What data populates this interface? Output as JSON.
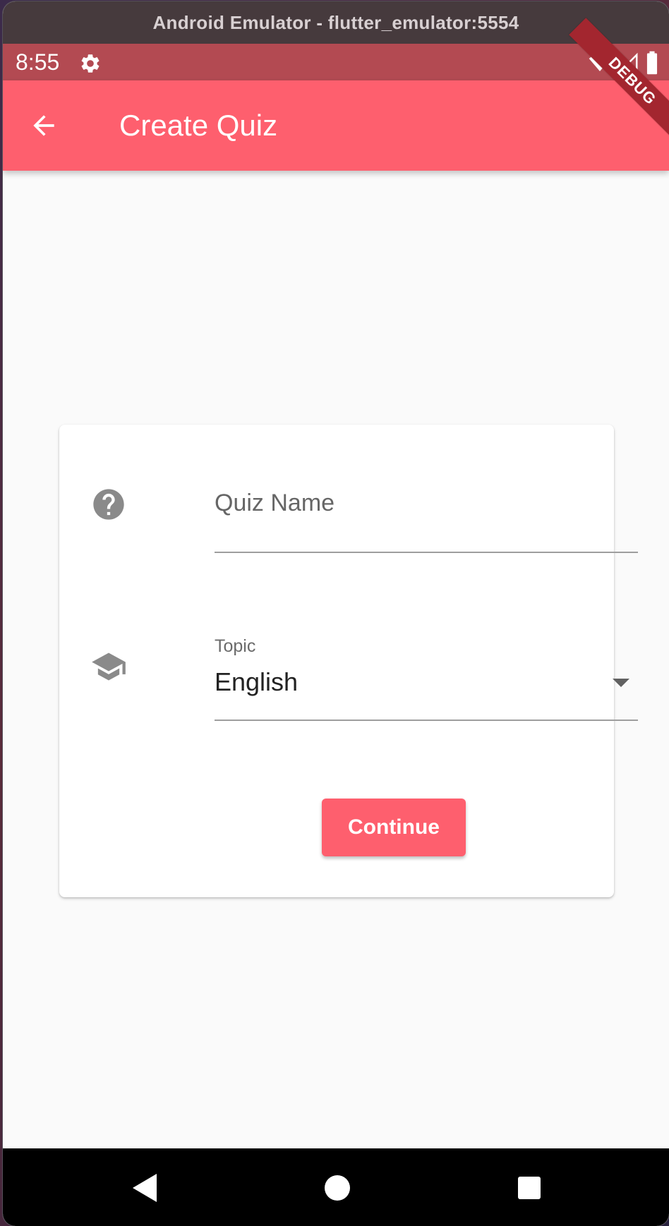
{
  "window": {
    "title": "Android Emulator - flutter_emulator:5554"
  },
  "status_bar": {
    "time": "8:55",
    "icons": [
      "settings-gear-icon",
      "wifi-icon",
      "cell-signal-icon",
      "battery-icon"
    ],
    "debug_banner": "DEBUG"
  },
  "app_bar": {
    "title": "Create Quiz",
    "back_icon": "arrow-back-icon"
  },
  "form": {
    "quiz_name": {
      "icon": "help-circle-icon",
      "placeholder": "Quiz Name",
      "value": ""
    },
    "topic": {
      "icon": "school-cap-icon",
      "label": "Topic",
      "selected": "English"
    },
    "continue_label": "Continue"
  },
  "nav_bar": {
    "buttons": [
      "back-triangle-icon",
      "home-circle-icon",
      "recents-square-icon"
    ]
  },
  "colors": {
    "primary": "#fe5f6e",
    "status_bar": "#b34a52",
    "background": "#fafafa",
    "debug_banner": "#a3262f"
  }
}
